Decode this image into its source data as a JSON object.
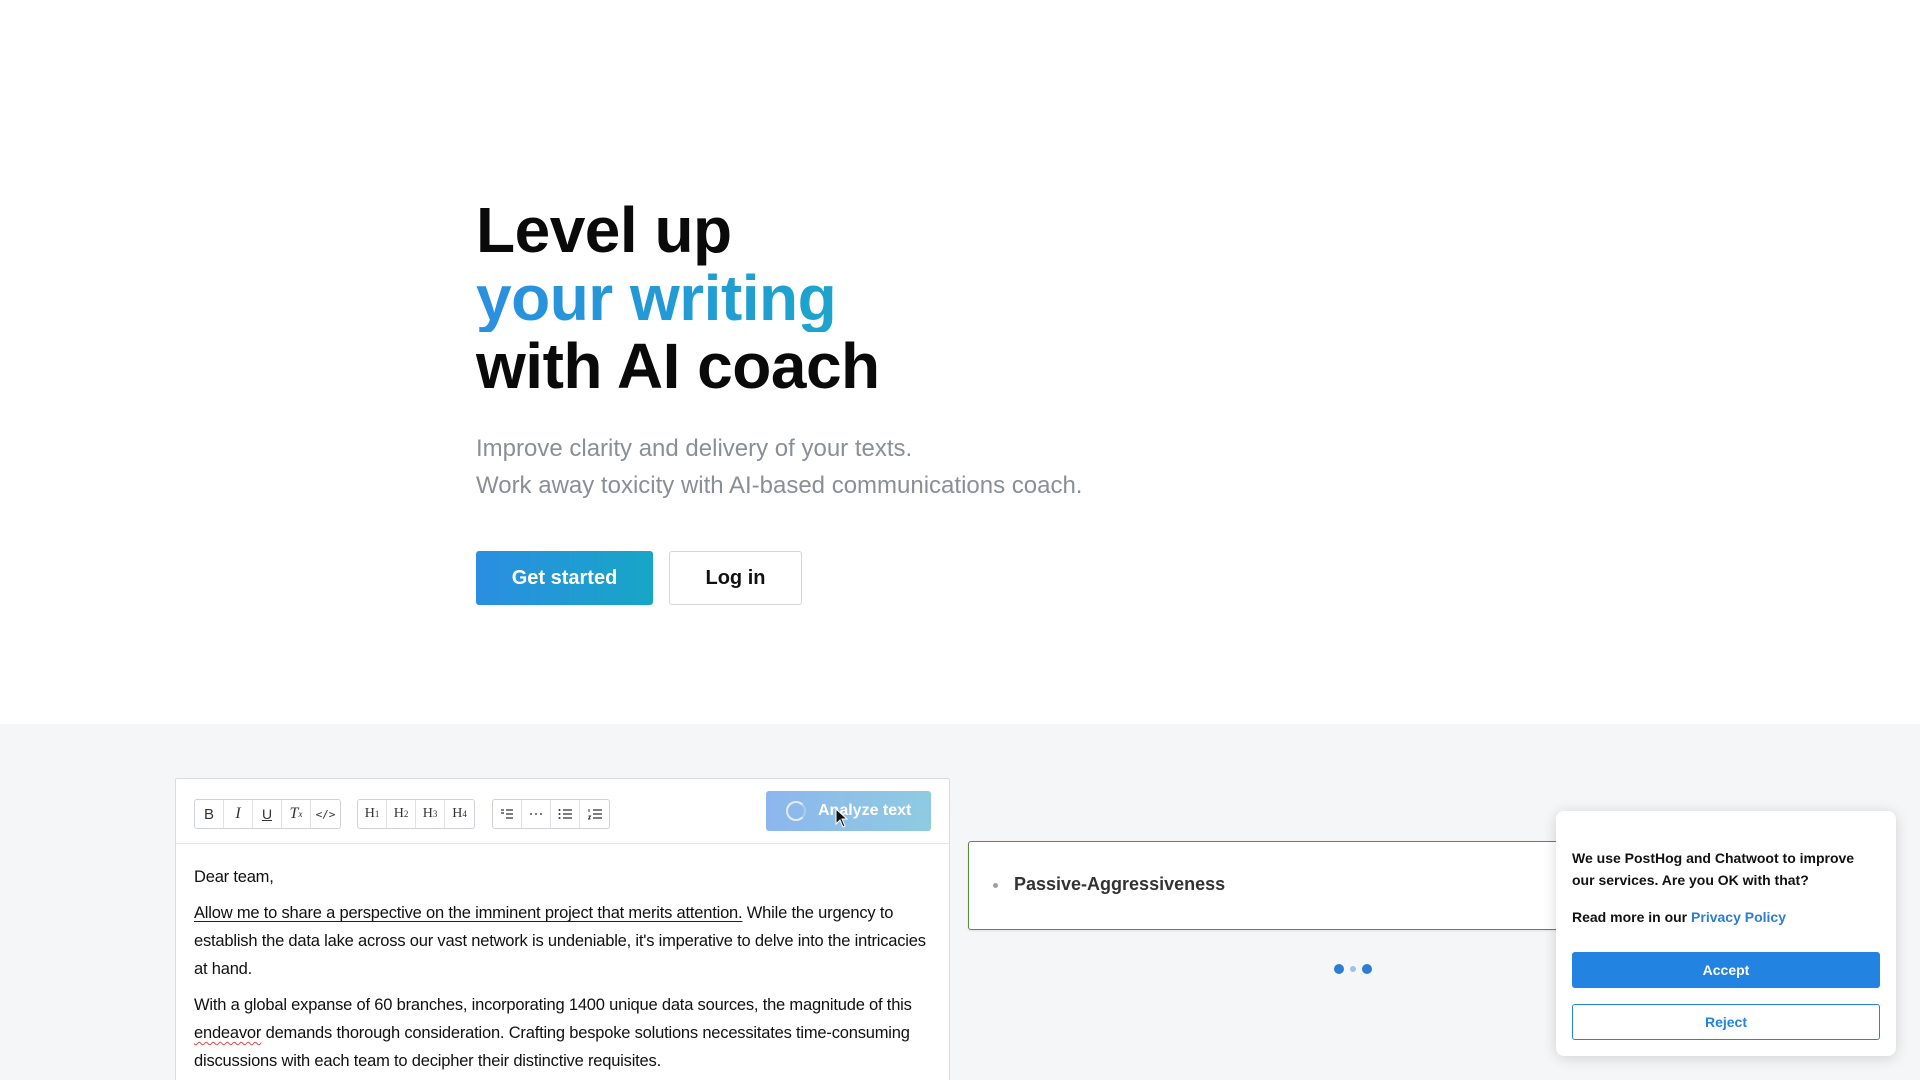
{
  "hero": {
    "headline_line1": "Level up",
    "headline_line2": "your writing",
    "headline_line3": "with AI coach",
    "subtitle_line1": "Improve clarity and delivery of your texts.",
    "subtitle_line2": "Work away toxicity with AI-based communications coach.",
    "cta_primary": "Get started",
    "cta_secondary": "Log in",
    "accent_gradient": [
      "#2b8fe0",
      "#1aa7c9"
    ]
  },
  "editor": {
    "toolbar": {
      "format_group": [
        {
          "icon": "bold-icon",
          "label": "B"
        },
        {
          "icon": "italic-icon",
          "label": "I"
        },
        {
          "icon": "underline-icon",
          "label": "U"
        },
        {
          "icon": "clear-format-icon",
          "label": "Tx"
        },
        {
          "icon": "code-icon",
          "label": "</>"
        }
      ],
      "heading_group": [
        {
          "icon": "heading1-icon",
          "label": "H1"
        },
        {
          "icon": "heading2-icon",
          "label": "H2"
        },
        {
          "icon": "heading3-icon",
          "label": "H3"
        },
        {
          "icon": "heading4-icon",
          "label": "H4"
        }
      ],
      "block_group": [
        {
          "icon": "blockquote-icon",
          "label": "quote"
        },
        {
          "icon": "horizontal-rule-icon",
          "label": "---"
        },
        {
          "icon": "bullet-list-icon",
          "label": "bullets"
        },
        {
          "icon": "numbered-list-icon",
          "label": "numbers"
        }
      ],
      "analyze_label": "Analyze text"
    },
    "paragraphs": {
      "p1": "Dear team,",
      "p2_highlight": "Allow me to share a perspective on the imminent project that merits attention.",
      "p2_rest": " While the urgency to establish the data lake across our vast network is undeniable, it's imperative to delve into the intricacies at hand.",
      "p3_start": "With a global expanse of 60 branches, incorporating 1400 unique data sources, the magnitude of this ",
      "p3_misspelled": "endeavor",
      "p3_end": " demands thorough consideration. Crafting bespoke solutions necessitates time-consuming discussions with each team to decipher their distinctive requisites."
    }
  },
  "analysis": {
    "result_label": "Passive-Aggressiveness",
    "result_border_color": "#5d8a43",
    "pager_dots": 3
  },
  "consent": {
    "message": "We use PostHog and Chatwoot to improve our services. Are you OK with that?",
    "read_more_prefix": "Read more in our ",
    "privacy_link": "Privacy Policy",
    "accept_label": "Accept",
    "reject_label": "Reject",
    "accent_color": "#2283e0"
  }
}
